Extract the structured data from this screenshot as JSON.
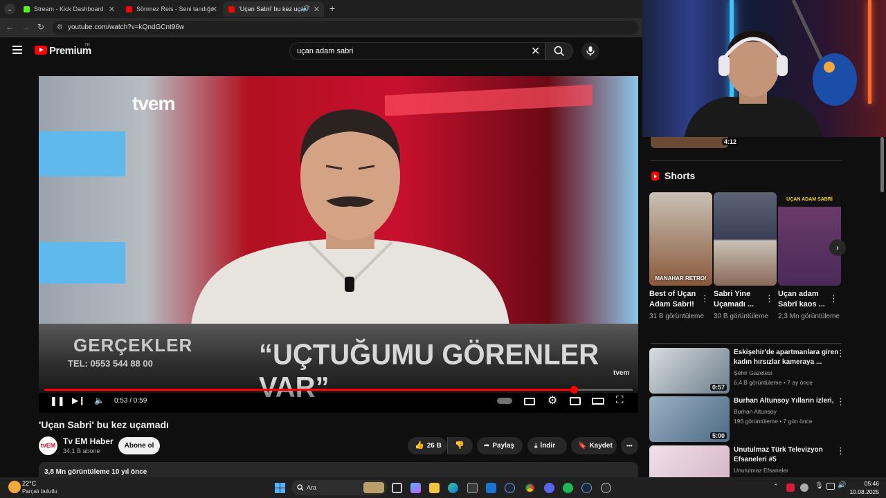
{
  "browser": {
    "tabs": [
      {
        "label": "Stream - Kick Dashboard",
        "color": "#53fc18"
      },
      {
        "label": "Sönmez Reis - Seni tandığım g",
        "color": "#ff0000"
      },
      {
        "label": "'Uçan Sabri' bu kez uçamad",
        "color": "#ff0000"
      }
    ],
    "new_tab": "+",
    "url": "youtube.com/watch?v=kQndGCnt96w"
  },
  "youtube": {
    "logo_text": "Premium",
    "region": "TR",
    "search_query": "uçan adam sabri"
  },
  "video": {
    "channel_logo_text": "tvem",
    "lower_third_brand": "GERÇEKLER",
    "lower_third_phone": "TEL: 0553 544 88 00",
    "lower_third_quote": "“UÇTUĞUMU GÖRENLER VAR”",
    "bug_text": "tvem",
    "time": "0:53 / 0:59",
    "progress": 0.9,
    "title": "'Uçan Sabri' bu kez uçamadı",
    "channel": "Tv EM Haber",
    "channel_avatar": "tvEM",
    "subscribers": "34,1 B abone",
    "subscribe_label": "Abone ol",
    "likes": "26 B",
    "share_label": "Paylaş",
    "download_label": "İndir",
    "save_label": "Kaydet",
    "more_label": "•••",
    "views_and_age": "3,8 Mn görüntüleme  10 yıl önce"
  },
  "sidebar": {
    "prev_duration": "4:12",
    "shorts_title": "Shorts",
    "shorts": [
      {
        "title": "Best of Uçan Adam Sabri!",
        "views": "31 B görüntüleme",
        "thumb_text": "MANAHAR RETRO!",
        "bg": "#8a5a3c"
      },
      {
        "title": "Sabri Yine Uçamadı ...",
        "views": "30 B görüntüleme",
        "thumb_text": "",
        "bg": "#3a3f55"
      },
      {
        "title": "Uçan adam Sabri kaos ...",
        "views": "2,3 Mn görüntüleme",
        "thumb_text": "UÇAN ADAM SABRİ",
        "bg": "#4a2a5a"
      }
    ],
    "recommended": [
      {
        "title": "Eskişehir'de apartmanlara giren kadın hırsızlar kameraya ...",
        "channel": "Şehir Gazetesi",
        "meta": "6,4 B görüntüleme • 7 ay önce",
        "duration": "0:57",
        "bg": "#6d7f8c"
      },
      {
        "title": "Burhan Altunsoy Yılların izleri,",
        "channel": "Burhan Altunsoy",
        "meta": "196 görüntüleme • 7 gün önce",
        "duration": "5:00",
        "bg": "#4d6a86"
      },
      {
        "title": "Unutulmaz Türk Televizyon Efsaneleri #5",
        "channel": "Unutulmaz Efsaneler",
        "meta": "",
        "duration": "",
        "bg": "#d7b8c8"
      }
    ]
  },
  "taskbar": {
    "temperature": "22°C",
    "weather": "Parçalı bulutlu",
    "search_label": "Ara",
    "time": "05:46",
    "date": "10.08.2025"
  }
}
